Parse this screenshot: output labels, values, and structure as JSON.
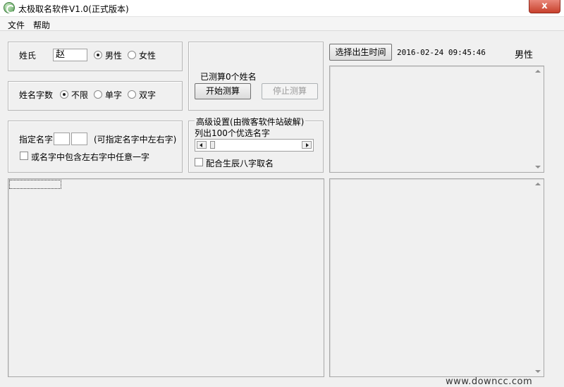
{
  "window": {
    "title": "太极取名软件V1.0(正式版本)",
    "close": "x"
  },
  "menu": [
    "文件",
    "帮助"
  ],
  "surname": {
    "label": "姓氏",
    "value": "赵",
    "male": "男性",
    "female": "女性"
  },
  "name_length": {
    "label": "姓名字数",
    "unlimited": "不限",
    "single": "单字",
    "double": "双字"
  },
  "specify": {
    "label": "指定名字",
    "hint": "(可指定名字中左右字)",
    "checkbox_label": "或名字中包含左右字中任意一字"
  },
  "calc": {
    "status": "已测算0个姓名",
    "start": "开始测算",
    "stop": "停止测算"
  },
  "advanced": {
    "title": "高级设置(由微客软件站破解)",
    "list_label": "列出100个优选名字",
    "bazi_label": "配合生辰八字取名",
    "slider_fraction": 0.02
  },
  "birth": {
    "button": "选择出生时间",
    "datetime": "2016-02-24 09:45:46",
    "gender": "男性"
  },
  "watermark": "www.downcc.com"
}
